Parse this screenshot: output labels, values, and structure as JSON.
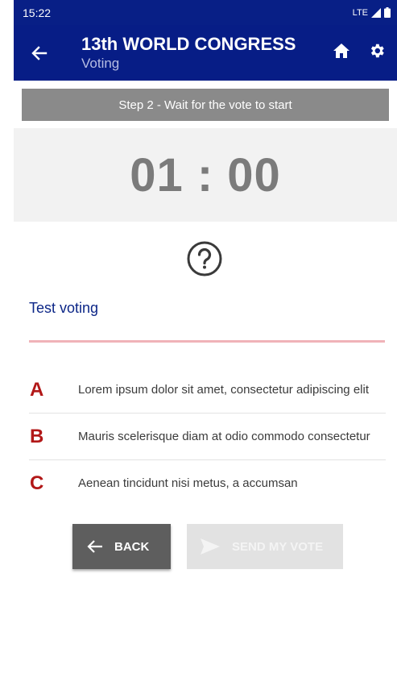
{
  "status_bar": {
    "time": "15:22",
    "network": "LTE"
  },
  "app_bar": {
    "title": "13th WORLD CONGRESS",
    "subtitle": "Voting"
  },
  "step_banner": "Step 2 - Wait for the vote to start",
  "timer": "01 : 00",
  "vote": {
    "title": "Test voting",
    "options": [
      {
        "letter": "A",
        "text": "Lorem ipsum dolor sit amet, consectetur adipiscing elit"
      },
      {
        "letter": "B",
        "text": "Mauris scelerisque diam at odio commodo consectetur"
      },
      {
        "letter": "C",
        "text": "Aenean tincidunt nisi metus, a accumsan"
      }
    ]
  },
  "buttons": {
    "back": "BACK",
    "send": "SEND MY VOTE"
  },
  "colors": {
    "app_bar": "#071d86",
    "accent_red": "#b21818",
    "divider": "#f0b3b8",
    "step_banner": "#8a8a8a"
  },
  "icons": [
    "back-arrow-icon",
    "home-icon",
    "gear-icon",
    "question-circle-icon",
    "send-icon",
    "lte-signal-icon",
    "battery-icon"
  ]
}
